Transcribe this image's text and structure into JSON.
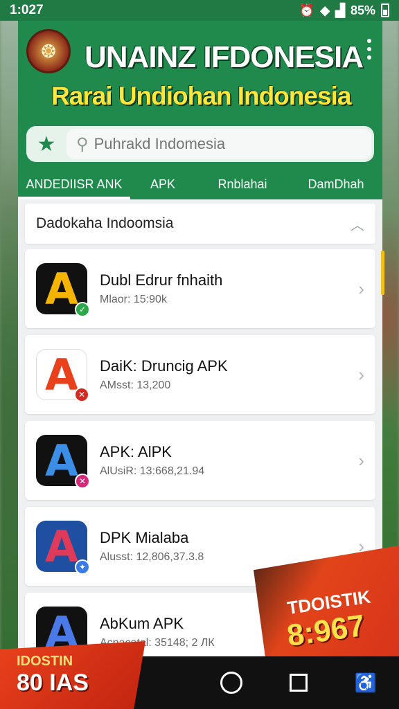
{
  "status": {
    "time": "1:027",
    "battery": "85%"
  },
  "header": {
    "title": "UNAINZ IFDONESIA",
    "subtitle": "Rarai Undiohan Indonesia",
    "brand_color": "#1f8a4c",
    "subtitle_color": "#ffe63a"
  },
  "search": {
    "placeholder": "Puhrakd Indomesia",
    "value": ""
  },
  "tabs": [
    {
      "label": "ANDEDIISR ANK",
      "active": true
    },
    {
      "label": "APK",
      "active": false
    },
    {
      "label": "Rnblahai",
      "active": false
    },
    {
      "label": "DamDhah",
      "active": false
    }
  ],
  "section": {
    "title": "Dadokaha Indoomsia"
  },
  "apps": [
    {
      "title": "Dubl Edrur fnhaith",
      "meta": "Mlaor: 15:90k",
      "icon": "A"
    },
    {
      "title": "DaiK: Druncig APK",
      "meta": "AMsst: 13,200",
      "icon": "A"
    },
    {
      "title": "APK: AlPK",
      "meta": "AlUsiR: 13:668,21.94",
      "icon": "A"
    },
    {
      "title": "DPK Mialaba",
      "meta": "Alusst: 12,806,37.3.8",
      "icon": "A"
    },
    {
      "title": "AbKum APK",
      "meta": "Acnacatal: 35148; 2 ЛК",
      "icon": "A"
    }
  ],
  "promo": {
    "left_line1": "IDOSTIN",
    "left_line2": "80 IAS",
    "right_line1": "TDOISTIK",
    "right_line2": "8:967"
  },
  "icons": [
    "alarm-icon",
    "wifi-icon",
    "signal-icon",
    "battery-icon",
    "emblem-icon",
    "more-vert-icon",
    "star-icon",
    "search-icon",
    "chevron-up-icon",
    "chevron-right-icon",
    "home-icon",
    "recents-icon",
    "accessibility-icon"
  ]
}
